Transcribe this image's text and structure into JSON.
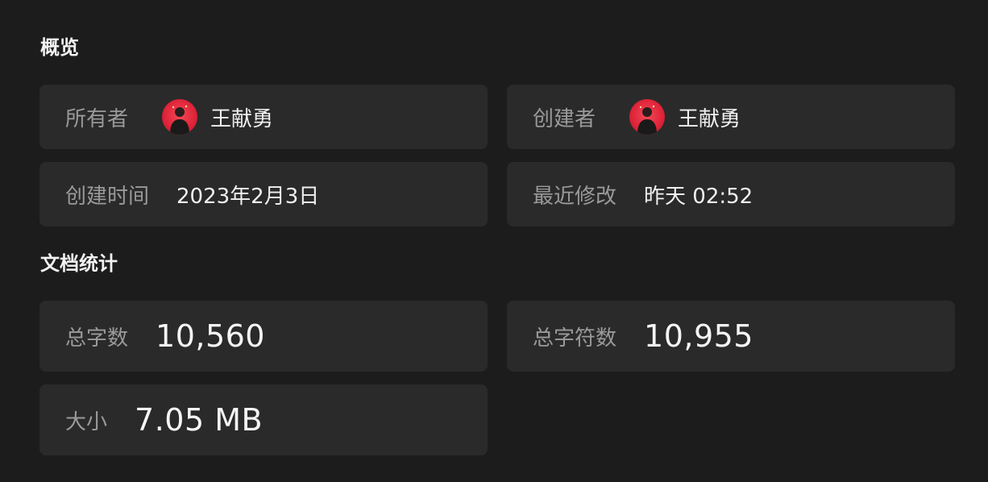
{
  "sections": {
    "overview_title": "概览",
    "stats_title": "文档统计"
  },
  "overview": {
    "owner": {
      "label": "所有者",
      "name": "王献勇",
      "avatar_icon": "user-avatar"
    },
    "creator": {
      "label": "创建者",
      "name": "王献勇",
      "avatar_icon": "user-avatar"
    },
    "created_time": {
      "label": "创建时间",
      "value": "2023年2月3日"
    },
    "modified_time": {
      "label": "最近修改",
      "value": "昨天 02:52"
    }
  },
  "stats": {
    "word_count": {
      "label": "总字数",
      "value": "10,560"
    },
    "char_count": {
      "label": "总字符数",
      "value": "10,955"
    },
    "size": {
      "label": "大小",
      "value": "7.05 MB"
    }
  },
  "colors": {
    "background": "#1c1c1c",
    "card": "#2a2a2a",
    "label": "#9a9a9a",
    "value": "#f0f0f0",
    "avatar_accent": "#e0253a"
  }
}
